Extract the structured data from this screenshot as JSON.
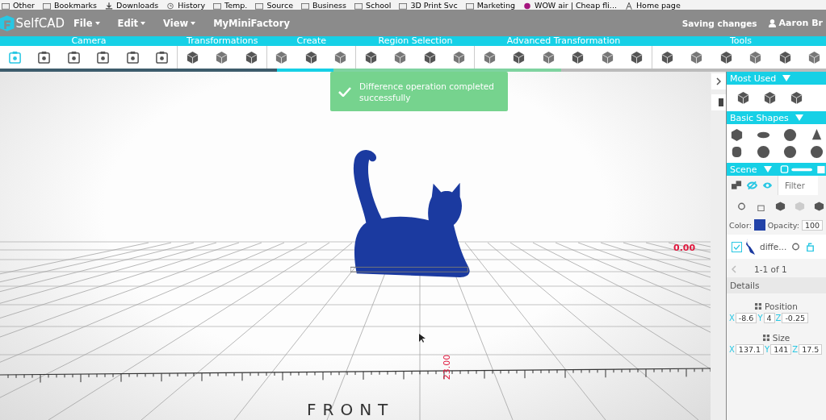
{
  "bookmarks": [
    {
      "label": "Other",
      "kind": "folder"
    },
    {
      "label": "Bookmarks",
      "kind": "folder"
    },
    {
      "label": "Downloads",
      "kind": "download"
    },
    {
      "label": "History",
      "kind": "history"
    },
    {
      "label": "Temp.",
      "kind": "folder"
    },
    {
      "label": "Source",
      "kind": "folder"
    },
    {
      "label": "Business",
      "kind": "folder"
    },
    {
      "label": "School",
      "kind": "folder"
    },
    {
      "label": "3D Print Svc",
      "kind": "folder"
    },
    {
      "label": "Marketing",
      "kind": "folder"
    },
    {
      "label": "WOW air | Cheap fli...",
      "kind": "site"
    },
    {
      "label": "Home page",
      "kind": "page"
    }
  ],
  "app": {
    "logo": "SelfCAD",
    "menus": [
      {
        "label": "File",
        "dropdown": true
      },
      {
        "label": "Edit",
        "dropdown": true
      },
      {
        "label": "View",
        "dropdown": true
      },
      {
        "label": "MyMiniFactory",
        "dropdown": false
      }
    ],
    "status": "Saving changes",
    "user": "Aaron Br"
  },
  "toolbar": [
    {
      "label": "Camera",
      "tools": [
        {
          "selected": true
        },
        {
          "selected": false
        },
        {
          "selected": false
        },
        {
          "selected": false
        },
        {
          "selected": false
        },
        {
          "selected": false
        }
      ]
    },
    {
      "label": "Transformations",
      "tools": [
        {
          "selected": false
        },
        {
          "selected": false
        },
        {
          "selected": false
        }
      ]
    },
    {
      "label": "Create",
      "tools": [
        {
          "selected": false
        },
        {
          "selected": false
        },
        {
          "selected": false
        }
      ]
    },
    {
      "label": "Region Selection",
      "tools": [
        {
          "selected": false
        },
        {
          "selected": false
        },
        {
          "selected": false
        },
        {
          "selected": false
        }
      ]
    },
    {
      "label": "Advanced Transformation",
      "tools": [
        {
          "selected": false
        },
        {
          "selected": false
        },
        {
          "selected": false
        },
        {
          "selected": false
        },
        {
          "selected": false
        },
        {
          "selected": false
        }
      ]
    },
    {
      "label": "Tools",
      "tools": [
        {
          "selected": false
        },
        {
          "selected": false
        },
        {
          "selected": false
        },
        {
          "selected": false
        },
        {
          "selected": false
        },
        {
          "selected": false
        }
      ]
    }
  ],
  "toast": {
    "message": "Difference operation completed successfully"
  },
  "viewport": {
    "x_reading": "0.00",
    "z_reading": "23.00",
    "side_label": "FRONT"
  },
  "panel": {
    "most_used": {
      "title": "Most Used"
    },
    "basic_shapes": {
      "title": "Basic Shapes"
    },
    "scene": {
      "title": "Scene",
      "filter": {
        "placeholder": "Filter"
      },
      "color_label": "Color:",
      "color": "#2343a8",
      "opacity_label": "Opacity:",
      "opacity": "100",
      "objects": [
        {
          "name": "diffe...",
          "checked": true
        }
      ],
      "pagination": "1-1 of 1"
    },
    "details": {
      "title": "Details",
      "groups": [
        {
          "title": "Position",
          "fields": [
            {
              "axis": "X",
              "value": "-8.6"
            },
            {
              "axis": "Y",
              "value": "4"
            },
            {
              "axis": "Z",
              "value": "-0.25"
            }
          ]
        },
        {
          "title": "Size",
          "fields": [
            {
              "axis": "X",
              "value": "137.1"
            },
            {
              "axis": "Y",
              "value": "141"
            },
            {
              "axis": "Z",
              "value": "17.5"
            }
          ]
        }
      ]
    }
  }
}
